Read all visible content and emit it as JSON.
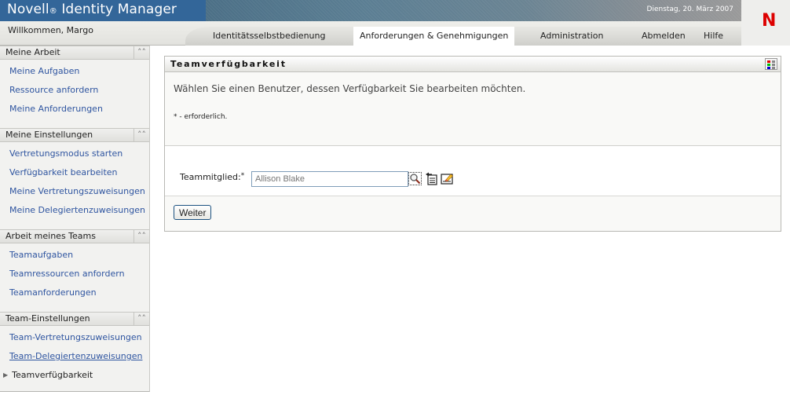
{
  "header": {
    "brand": "Novell",
    "brand_reg": "®",
    "product": "Identity Manager",
    "date": "Dienstag, 20. März 2007",
    "welcome": "Willkommen, Margo",
    "logo_letter": "N",
    "logo_color": "#dd0000",
    "tabs": [
      {
        "label": "Identitätsselbstbedienung",
        "active": false
      },
      {
        "label": "Anforderungen & Genehmigungen",
        "active": true
      },
      {
        "label": "Administration",
        "active": false
      }
    ],
    "links": {
      "logout": "Abmelden",
      "help": "Hilfe"
    }
  },
  "sidebar": {
    "collapse_icon": "double-chevron-up-icon",
    "sections": [
      {
        "title": "Meine Arbeit",
        "items": [
          {
            "label": "Meine Aufgaben"
          },
          {
            "label": "Ressource anfordern"
          },
          {
            "label": "Meine Anforderungen"
          }
        ]
      },
      {
        "title": "Meine Einstellungen",
        "items": [
          {
            "label": "Vertretungsmodus starten"
          },
          {
            "label": "Verfügbarkeit bearbeiten"
          },
          {
            "label": "Meine Vertretungszuweisungen"
          },
          {
            "label": "Meine Delegiertenzuweisungen"
          }
        ]
      },
      {
        "title": "Arbeit meines Teams",
        "items": [
          {
            "label": "Teamaufgaben"
          },
          {
            "label": "Teamressourcen anfordern"
          },
          {
            "label": "Teamanforderungen"
          }
        ]
      },
      {
        "title": "Team-Einstellungen",
        "items": [
          {
            "label": "Team-Vertretungszuweisungen"
          },
          {
            "label": "Team-Delegiertenzuweisungen"
          },
          {
            "label": "Teamverfügbarkeit",
            "current": true
          }
        ]
      }
    ]
  },
  "panel": {
    "title": "Teamverfügbarkeit",
    "intro": "Wählen Sie einen Benutzer, dessen Verfügbarkeit Sie bearbeiten möchten.",
    "required_note": "* - erforderlich.",
    "member_label": "Teammitglied:",
    "required_mark": "*",
    "member_placeholder": "Allison Blake",
    "member_value": "",
    "icons": [
      "search-icon",
      "history-list-icon",
      "clear-edit-icon"
    ],
    "next_button": "Weiter"
  }
}
